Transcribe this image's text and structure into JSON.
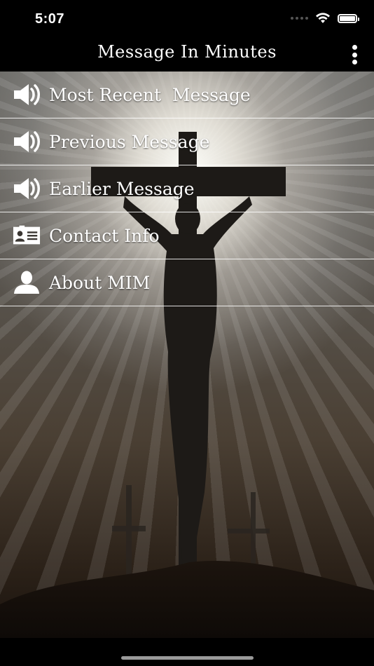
{
  "status_bar": {
    "time": "5:07"
  },
  "nav_bar": {
    "title": "Message In Minutes"
  },
  "menu": {
    "items": [
      {
        "label": "Most Recent  Message",
        "icon": "speaker-icon"
      },
      {
        "label": "Previous Message",
        "icon": "speaker-icon"
      },
      {
        "label": "Earlier Message",
        "icon": "speaker-icon"
      },
      {
        "label": "Contact Info",
        "icon": "contact-card-icon"
      },
      {
        "label": "About MIM",
        "icon": "person-icon"
      }
    ]
  },
  "colors": {
    "bar_background": "#000000",
    "text": "#ffffff",
    "divider": "#ffffff"
  }
}
